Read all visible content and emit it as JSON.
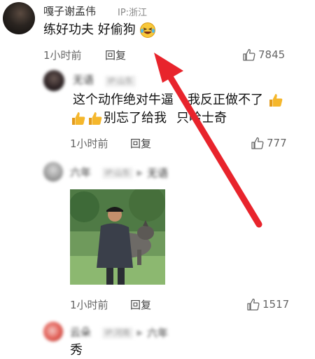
{
  "main_comment": {
    "username": "嘎子谢孟伟",
    "ip": "IP:浙江",
    "text": "练好功夫 好偷狗",
    "time": "1小时前",
    "reply": "回复",
    "likes": "7845"
  },
  "reply1": {
    "username": "无语",
    "ip_tag": "IP:山东",
    "text_line1": "这个动作绝对牛逼",
    "text_line1b": "我反正做不了",
    "text_line2": "别忘了给我",
    "text_line2b": "只哈士奇",
    "time": "1小时前",
    "reply": "回复",
    "likes": "777"
  },
  "reply2": {
    "username": "六年",
    "ip_tag": "IP:山东",
    "reply_to": "无语",
    "time": "1小时前",
    "reply": "回复",
    "likes": "1517"
  },
  "reply3": {
    "username": "云朵",
    "ip_tag": "IP:河南",
    "reply_to": "六年",
    "text": "秀"
  },
  "colors": {
    "arrow": "#e8242c",
    "emoji_thumb": "#f5b72c",
    "text_muted": "#666666"
  },
  "icons": [
    "thumbs-up-icon",
    "laughing-emoji-icon",
    "reply-arrow-icon"
  ]
}
